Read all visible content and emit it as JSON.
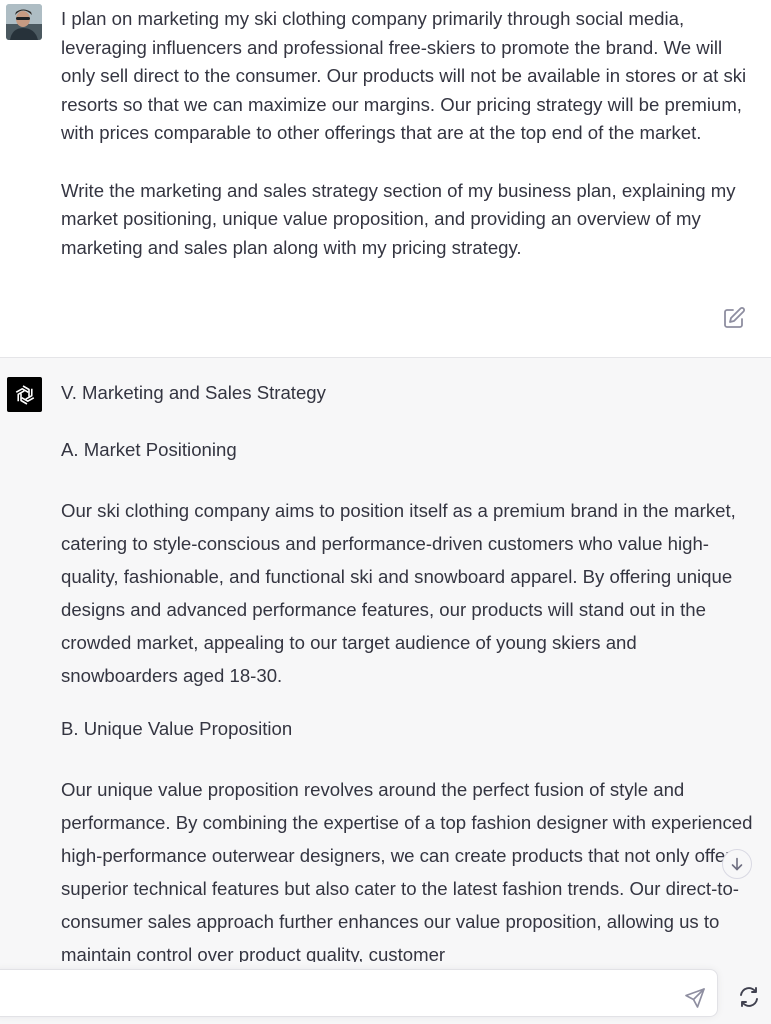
{
  "user_message": {
    "paragraphs": [
      "I plan on marketing my ski clothing company primarily through social media, leveraging influencers and professional free-skiers to promote the brand. We will only sell direct to the consumer. Our products will not be available in stores or at ski resorts so that we can maximize our margins. Our pricing strategy will be premium, with prices comparable to other offerings that are at the top end of the market.",
      "Write the marketing and sales strategy section of my business plan, explaining my market positioning, unique value proposition, and providing an overview of my marketing and sales plan along with my pricing strategy."
    ]
  },
  "assistant_message": {
    "title": "V. Marketing and Sales Strategy",
    "section_a_heading": "A. Market Positioning",
    "section_a_body": "Our ski clothing company aims to position itself as a premium brand in the market, catering to style-conscious and performance-driven customers who value high-quality, fashionable, and functional ski and snowboard apparel. By offering unique designs and advanced performance features, our products will stand out in the crowded market, appealing to our target audience of young skiers and snowboarders aged 18-30.",
    "section_b_heading": "B. Unique Value Proposition",
    "section_b_body": "Our unique value proposition revolves around the perfect fusion of style and performance. By combining the expertise of a top fashion designer with experienced high-performance outerwear designers, we can create products that not only offer superior technical features but also cater to the latest fashion trends. Our direct-to-consumer sales approach further enhances our value proposition, allowing us to maintain control over product quality, customer"
  },
  "composer": {
    "value": "",
    "placeholder": ""
  },
  "icons": {
    "edit": "edit-icon",
    "send": "send-icon",
    "regenerate": "regenerate-icon",
    "scroll": "arrow-down-icon",
    "openai_logo": "openai-logo-icon"
  },
  "colors": {
    "text": "#343541",
    "assistant_bg": "#f7f7f8",
    "user_bg": "#ffffff",
    "icon": "#8e8ea0"
  }
}
